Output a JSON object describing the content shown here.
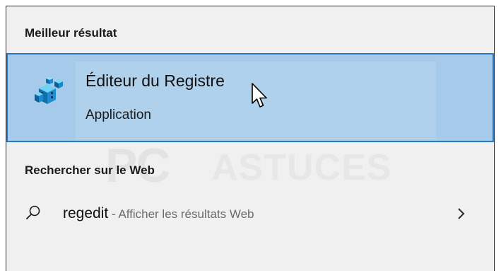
{
  "best_match": {
    "header": "Meilleur résultat",
    "app_title": "Éditeur du Registre",
    "app_type": "Application"
  },
  "web": {
    "header": "Rechercher sur le Web",
    "query": "regedit",
    "suffix": " - Afficher les résultats Web"
  },
  "watermark": {
    "part1": "PC",
    "part2": "ASTUCES"
  },
  "icons": {
    "app": "registry-editor-icon",
    "search": "search-icon",
    "chevron": "chevron-right-icon",
    "cursor": "mouse-pointer-icon"
  },
  "colors": {
    "selection_fill": "#a6cbea",
    "selection_border": "#2b79c2",
    "panel_bg": "#f0f0f0"
  }
}
